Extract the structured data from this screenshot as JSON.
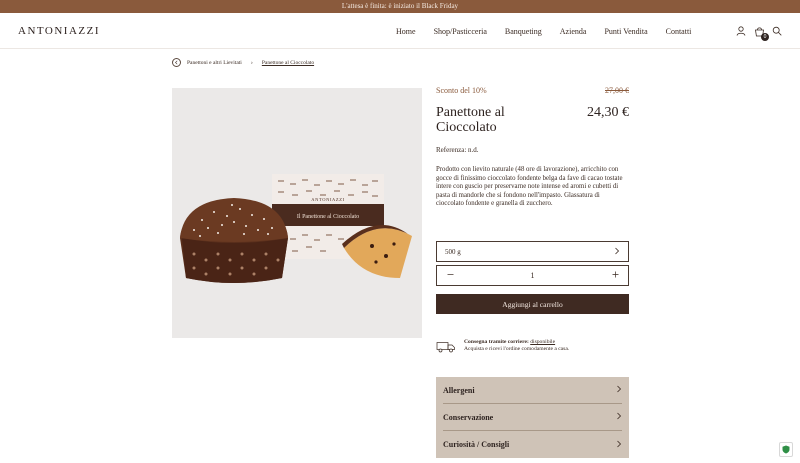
{
  "announcement": "L'attesa è finita: è iniziato il Black Friday",
  "brand": "ANTONIAZZI",
  "nav": [
    "Home",
    "Shop/Pasticceria",
    "Banqueting",
    "Azienda",
    "Punti Vendita",
    "Contatti"
  ],
  "cart": {
    "count": "0"
  },
  "breadcrumb": {
    "parent": "Panettoni e altri Lievitati",
    "current": "Panettone al Cioccolato"
  },
  "product": {
    "image_box_title": "Il Panettone al Cioccolato",
    "image_box_brand": "ANTONIAZZI",
    "discount": "Sconto del 10%",
    "old_price": "27,00 €",
    "title": "Panettone al Cioccolato",
    "price": "24,30 €",
    "reference": "Referenza: n.d.",
    "description": "Prodotto con lievito naturale (48 ore di lavorazione), arricchito con gocce di finissimo cioccolato fondente belga da fave di cacao tostate intere con guscio per preservarne note intense ed aromi e cubetti di pasta di mandorle che si fondono nell'impasto. Glassatura di cioccolato fondente e granella di zucchero.",
    "weight_option": "500 g",
    "quantity": "1",
    "add_to_cart": "Aggiungi al carrello"
  },
  "delivery": {
    "label": "Consegna tramite corriere:",
    "status": "disponibile",
    "note": "Acquista e ricevi l'ordine comodamente a casa."
  },
  "accordion": [
    "Allergeni",
    "Conservazione",
    "Curiosità / Consigli"
  ],
  "colors": {
    "accent": "#8a5a3c",
    "button": "#3f2a22",
    "accordion_bg": "#cfc3b7"
  }
}
